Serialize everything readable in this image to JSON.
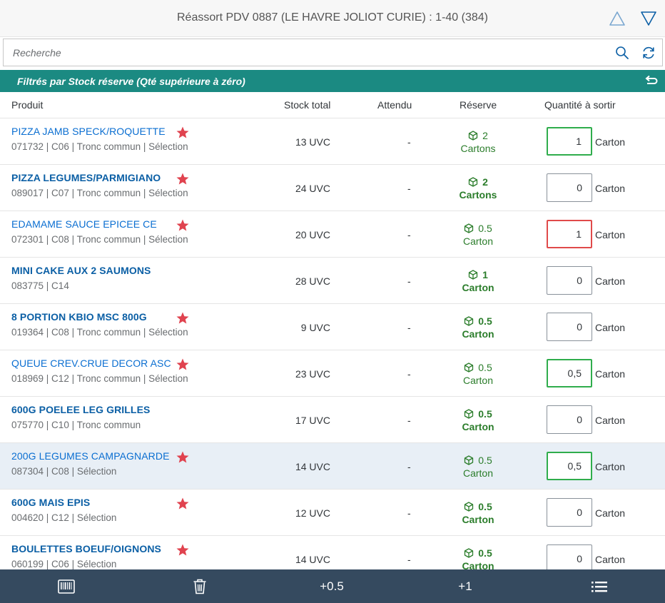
{
  "header": {
    "title": "Réassort PDV 0887 (LE HAVRE JOLIOT CURIE) : 1-40 (384)",
    "nav_up_icon": "triangle-up-icon",
    "nav_down_icon": "triangle-down-icon"
  },
  "search": {
    "placeholder": "Recherche",
    "value": "",
    "search_icon": "search-icon",
    "refresh_icon": "refresh-icon"
  },
  "filter": {
    "text": "Filtrés par Stock réserve (Qté supérieure à zéro)",
    "undo_icon": "undo-icon"
  },
  "columns": {
    "produit": "Produit",
    "stock_total": "Stock total",
    "attendu": "Attendu",
    "reserve": "Réserve",
    "quantite": "Quantité à sortir"
  },
  "rows": [
    {
      "name": "PIZZA JAMB SPECK/ROQUETTE",
      "meta": "071732 | C06 | Tronc commun | Sélection",
      "starred": true,
      "stock": "13 UVC",
      "attendu": "-",
      "reserve_qty": "2",
      "reserve_unit": "Cartons",
      "qty": "1",
      "unit": "Carton",
      "state": "ok",
      "bold": false,
      "selected": false
    },
    {
      "name": "PIZZA LEGUMES/PARMIGIANO",
      "meta": "089017 | C07 | Tronc commun | Sélection",
      "starred": true,
      "stock": "24 UVC",
      "attendu": "-",
      "reserve_qty": "2",
      "reserve_unit": "Cartons",
      "qty": "0",
      "unit": "Carton",
      "state": "none",
      "bold": true,
      "selected": false
    },
    {
      "name": "EDAMAME SAUCE EPICEE CE",
      "meta": "072301 | C08 | Tronc commun | Sélection",
      "starred": true,
      "stock": "20 UVC",
      "attendu": "-",
      "reserve_qty": "0.5",
      "reserve_unit": "Carton",
      "qty": "1",
      "unit": "Carton",
      "state": "err",
      "bold": false,
      "selected": false
    },
    {
      "name": "MINI CAKE AUX 2 SAUMONS",
      "meta": "083775 | C14",
      "starred": false,
      "stock": "28 UVC",
      "attendu": "-",
      "reserve_qty": "1",
      "reserve_unit": "Carton",
      "qty": "0",
      "unit": "Carton",
      "state": "none",
      "bold": true,
      "selected": false
    },
    {
      "name": "8 PORTION KBIO MSC 800G",
      "meta": "019364 | C08 | Tronc commun | Sélection",
      "starred": true,
      "stock": "9 UVC",
      "attendu": "-",
      "reserve_qty": "0.5",
      "reserve_unit": "Carton",
      "qty": "0",
      "unit": "Carton",
      "state": "none",
      "bold": true,
      "selected": false
    },
    {
      "name": "QUEUE CREV.CRUE DECOR ASC",
      "meta": "018969 | C12 | Tronc commun | Sélection",
      "starred": true,
      "stock": "23 UVC",
      "attendu": "-",
      "reserve_qty": "0.5",
      "reserve_unit": "Carton",
      "qty": "0,5",
      "unit": "Carton",
      "state": "ok",
      "bold": false,
      "selected": false
    },
    {
      "name": "600G POELEE LEG GRILLES",
      "meta": "075770 | C10 | Tronc commun",
      "starred": false,
      "stock": "17 UVC",
      "attendu": "-",
      "reserve_qty": "0.5",
      "reserve_unit": "Carton",
      "qty": "0",
      "unit": "Carton",
      "state": "none",
      "bold": true,
      "selected": false
    },
    {
      "name": "200G LEGUMES CAMPAGNARDE",
      "meta": "087304 | C08 | Sélection",
      "starred": true,
      "stock": "14 UVC",
      "attendu": "-",
      "reserve_qty": "0.5",
      "reserve_unit": "Carton",
      "qty": "0,5",
      "unit": "Carton",
      "state": "ok",
      "bold": false,
      "selected": true
    },
    {
      "name": "600G MAIS EPIS",
      "meta": "004620 | C12 | Sélection",
      "starred": true,
      "stock": "12 UVC",
      "attendu": "-",
      "reserve_qty": "0.5",
      "reserve_unit": "Carton",
      "qty": "0",
      "unit": "Carton",
      "state": "none",
      "bold": true,
      "selected": false
    },
    {
      "name": "BOULETTES BOEUF/OIGNONS",
      "meta": "060199 | C06 | Sélection",
      "starred": true,
      "stock": "14 UVC",
      "attendu": "-",
      "reserve_qty": "0.5",
      "reserve_unit": "Carton",
      "qty": "0",
      "unit": "Carton",
      "state": "none",
      "bold": true,
      "selected": false
    }
  ],
  "footer": {
    "barcode_icon": "barcode-icon",
    "trash_icon": "trash-icon",
    "add_half_label": "+0.5",
    "add_one_label": "+1",
    "list_icon": "list-icon"
  },
  "colors": {
    "filter_bar": "#1b8a82",
    "footer": "#354a5f",
    "ok_border": "#2fad4c",
    "error_border": "#e04a4a",
    "star": "#e0434f",
    "reserve_green": "#2b7d2b",
    "link_blue": "#0a6ed1"
  }
}
